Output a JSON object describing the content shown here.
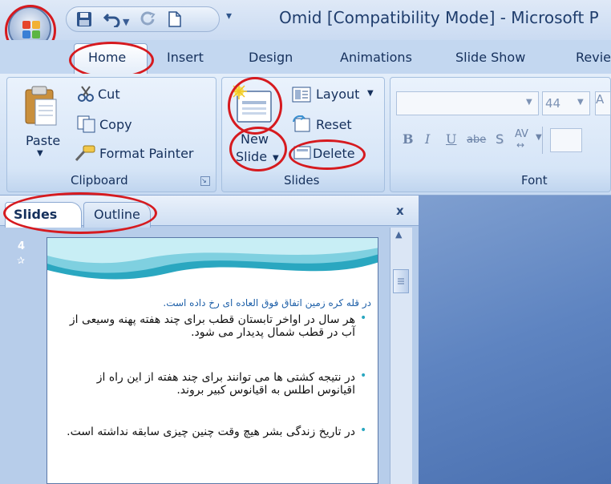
{
  "window": {
    "title": "Omid [Compatibility Mode] - Microsoft P"
  },
  "quick_access": {
    "icons": [
      "save-icon",
      "undo-icon",
      "redo-icon",
      "new-document-icon",
      "customize-dropdown-icon"
    ]
  },
  "tabs": [
    {
      "label": "Home",
      "active": true
    },
    {
      "label": "Insert"
    },
    {
      "label": "Design"
    },
    {
      "label": "Animations"
    },
    {
      "label": "Slide Show"
    },
    {
      "label": "Revie"
    }
  ],
  "clipboard": {
    "label": "Clipboard",
    "paste": "Paste",
    "cut": "Cut",
    "copy": "Copy",
    "format_painter": "Format Painter"
  },
  "slides_group": {
    "label": "Slides",
    "new_slide_line1": "New",
    "new_slide_line2": "Slide",
    "layout": "Layout",
    "reset": "Reset",
    "delete": "Delete"
  },
  "font_group": {
    "label": "Font",
    "size": "44",
    "buttons": [
      "B",
      "I",
      "U",
      "abe",
      "S",
      "AV"
    ]
  },
  "pane": {
    "tab_slides": "Slides",
    "tab_outline": "Outline",
    "close": "x",
    "slide_number": "4",
    "transition_symbol": "✰"
  },
  "slide": {
    "title": "در قله کره زمین اتفاق فوق العاده ای رخ داده است.",
    "bullets": [
      "هر سال در اواخر تابستان قطب برای چند هفته پهنه وسیعی از آب در قطب شمال پدیدار می شود.",
      "در نتیجه کشتی ها می توانند برای چند هفته از این راه از اقیانوس اطلس به اقیانوس کبیر بروند.",
      "در تاریخ زندگی بشر هیچ وقت چنین چیزی سابقه نداشته است."
    ]
  },
  "colors": {
    "highlight": "#d61a1f",
    "ribbon_text": "#15305c",
    "bullet": "#2aa7c0"
  }
}
